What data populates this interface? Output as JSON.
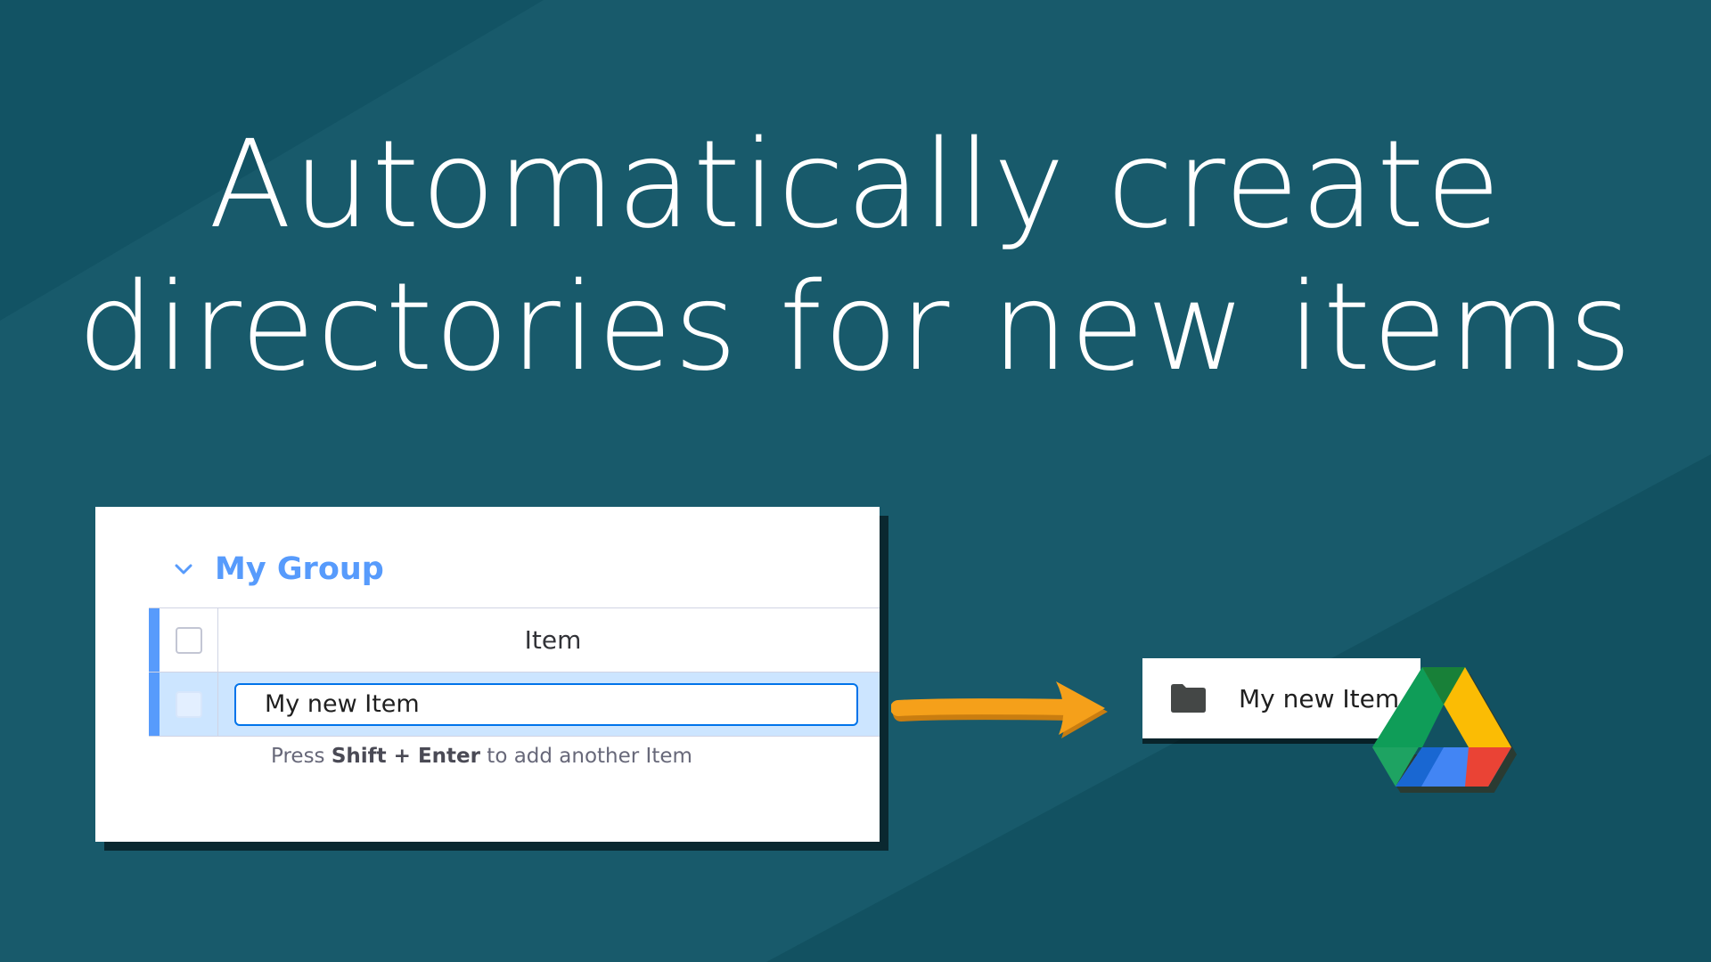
{
  "headline": {
    "line1": "Automatically create",
    "line2": "directories for new items"
  },
  "board": {
    "group_title": "My Group",
    "column_header": "Item",
    "input_value": "My new Item",
    "hint_prefix": "Press ",
    "hint_keys": "Shift + Enter",
    "hint_suffix": " to add another Item",
    "accent_color": "#579bfc"
  },
  "drive": {
    "folder_name": "My new Item",
    "icon": "folder-icon",
    "logo": "google-drive-logo"
  },
  "colors": {
    "background": "#185a6b",
    "arrow": "#f5a01a",
    "input_border": "#0073ea"
  }
}
